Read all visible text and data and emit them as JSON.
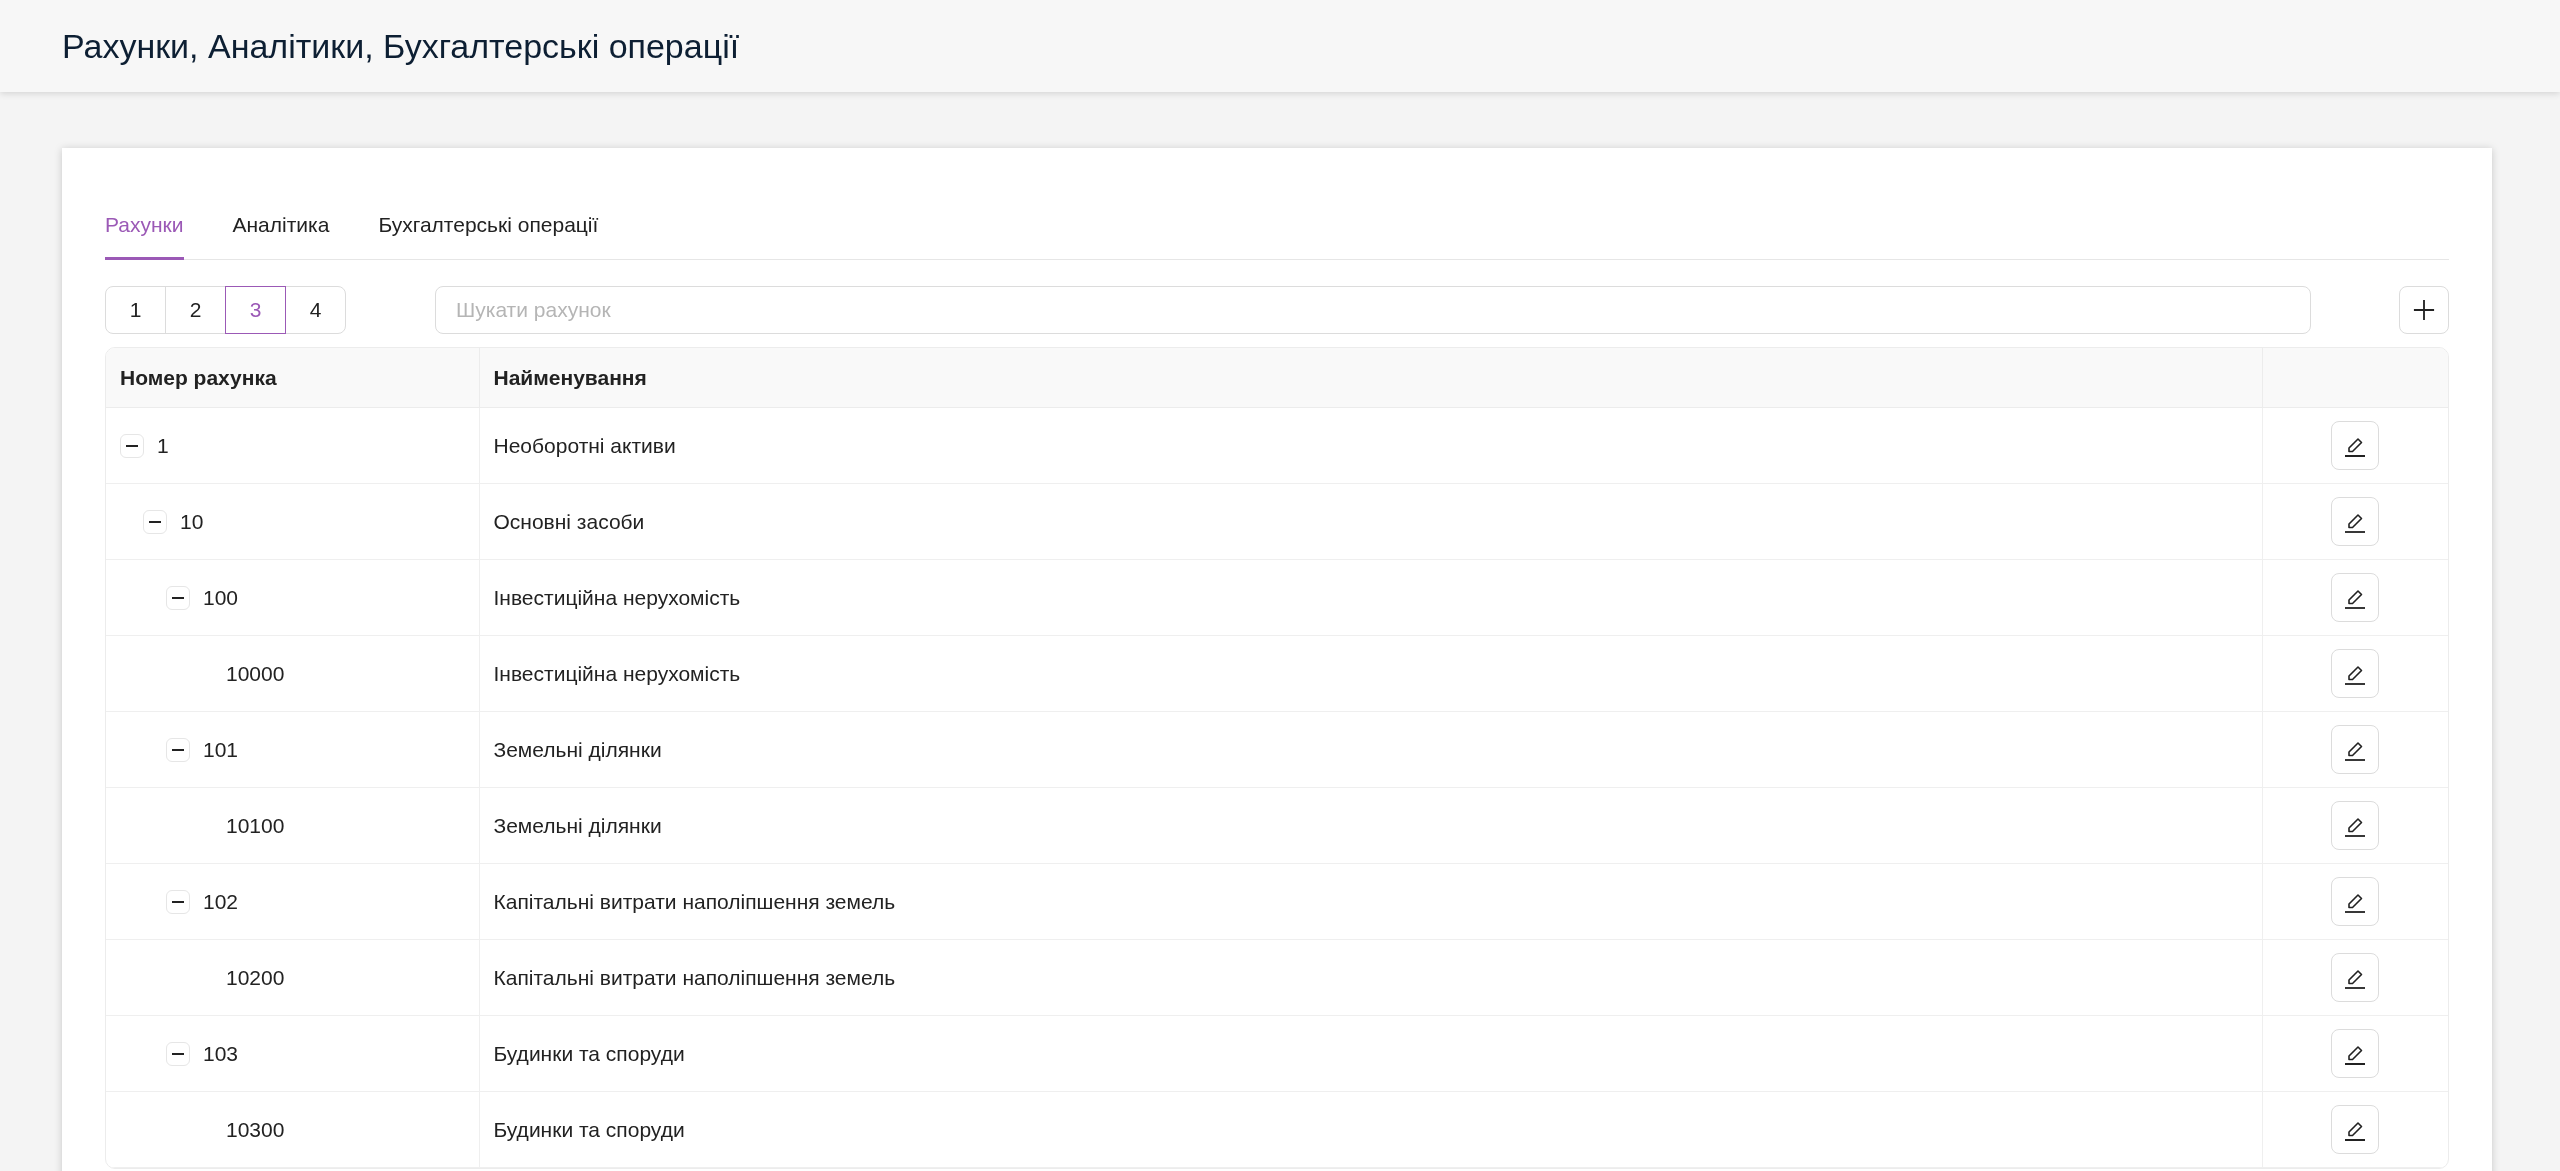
{
  "header": {
    "title": "Рахунки, Аналітики, Бухгалтерські операції"
  },
  "tabs": [
    {
      "label": "Рахунки",
      "selected": true
    },
    {
      "label": "Аналітика",
      "selected": false
    },
    {
      "label": "Бухгалтерські операції",
      "selected": false
    }
  ],
  "pagination": [
    {
      "label": "1",
      "selected": false
    },
    {
      "label": "2",
      "selected": false
    },
    {
      "label": "3",
      "selected": true
    },
    {
      "label": "4",
      "selected": false
    }
  ],
  "search": {
    "placeholder": "Шукати рахунок"
  },
  "table": {
    "columns": [
      "Номер рахунка",
      "Найменування"
    ],
    "rows": [
      {
        "number": "1",
        "name": "Необоротні активи",
        "expanded": true,
        "children": [
          {
            "number": "10",
            "name": "Основні засоби",
            "expanded": true,
            "children": [
              {
                "number": "100",
                "name": "Інвестиційна нерухомість",
                "expanded": true,
                "children": [
                  {
                    "number": "10000",
                    "name": "Інвестиційна нерухомість"
                  }
                ]
              },
              {
                "number": "101",
                "name": "Земельні ділянки",
                "expanded": true,
                "children": [
                  {
                    "number": "10100",
                    "name": "Земельні ділянки"
                  }
                ]
              },
              {
                "number": "102",
                "name": "Капітальні витрати наполіпшення земель",
                "expanded": true,
                "children": [
                  {
                    "number": "10200",
                    "name": "Капітальні витрати наполіпшення земель"
                  }
                ]
              },
              {
                "number": "103",
                "name": "Будинки та споруди",
                "expanded": true,
                "children": [
                  {
                    "number": "10300",
                    "name": "Будинки та споруди"
                  }
                ]
              }
            ]
          }
        ]
      }
    ]
  }
}
